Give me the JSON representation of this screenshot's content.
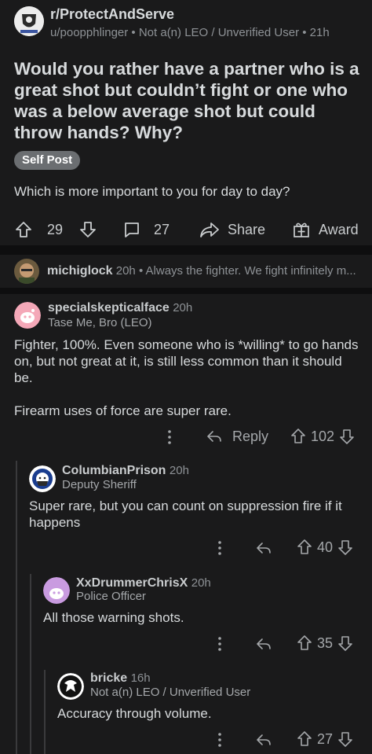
{
  "post": {
    "subreddit": "r/ProtectAndServe",
    "meta": "u/poopphlinger • Not a(n) LEO / Unverified User • 21h",
    "title": "Would you rather have a partner who is a great shot but couldn’t fight or one who was a below average shot but could throw hands? Why?",
    "flair": "Self Post",
    "body": "Which is more important to you for day to day?",
    "votes": "29",
    "comments": "27",
    "share_label": "Share",
    "award_label": "Award"
  },
  "collapsed_comment": {
    "author": "michiglock",
    "time": "20h",
    "preview": "• Always the fighter. We fight infinitely m..."
  },
  "comments": [
    {
      "author": "specialskepticalface",
      "time": "20h",
      "flair": "Tase Me, Bro (LEO)",
      "text1": "Fighter, 100%. Even someone who is *willing* to go hands on, but not great at it, is still less common than it should be.",
      "text2": "Firearm uses of force are super rare.",
      "reply_label": "Reply",
      "votes": "102"
    },
    {
      "author": "ColumbianPrison",
      "time": "20h",
      "flair": "Deputy Sheriff",
      "text": "Super rare, but you can count on suppression fire if it happens",
      "votes": "40"
    },
    {
      "author": "XxDrummerChrisX",
      "time": "20h",
      "flair": "Police Officer",
      "text": "All those warning shots.",
      "votes": "35"
    },
    {
      "author": "bricke",
      "time": "16h",
      "flair": "Not a(n) LEO / Unverified User",
      "text": "Accuracy through volume.",
      "votes": "27"
    }
  ],
  "icons": {
    "upvote": "arrow-up-icon",
    "downvote": "arrow-down-icon",
    "comment": "speech-bubble-icon",
    "share": "share-arrow-icon",
    "award": "gift-icon",
    "more": "vertical-dots-icon",
    "reply": "reply-arrow-icon"
  },
  "colors": {
    "background": "#1a1a1b",
    "separator": "#0e0e0f",
    "text": "#d7dadc",
    "muted": "#8e9296",
    "flair_bg": "#6b6e71"
  }
}
